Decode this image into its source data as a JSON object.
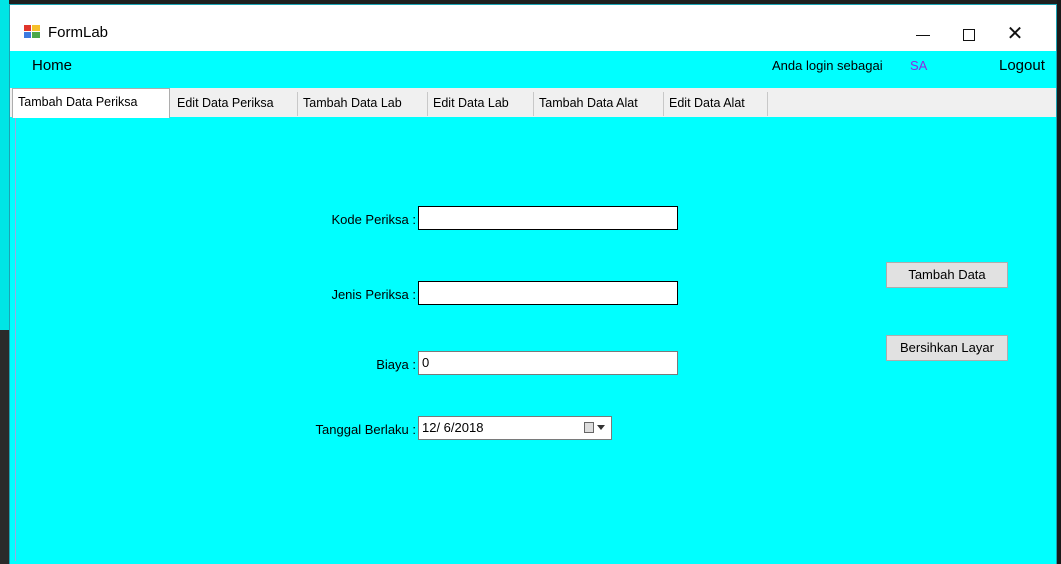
{
  "window": {
    "title": "FormLab",
    "controls": {
      "minimize": "—",
      "maximize": "☐",
      "close": "✕"
    }
  },
  "menu": {
    "home": "Home",
    "login_label": "Anda login sebagai",
    "login_user": "SA",
    "logout": "Logout"
  },
  "tabs": [
    {
      "label": "Tambah Data Periksa",
      "active": true
    },
    {
      "label": "Edit Data Periksa",
      "active": false
    },
    {
      "label": "Tambah Data Lab",
      "active": false
    },
    {
      "label": "Edit Data Lab",
      "active": false
    },
    {
      "label": "Tambah Data Alat",
      "active": false
    },
    {
      "label": "Edit Data Alat",
      "active": false
    }
  ],
  "form": {
    "kode_label": "Kode Periksa :",
    "kode_value": "",
    "jenis_label": "Jenis Periksa :",
    "jenis_value": "",
    "biaya_label": "Biaya :",
    "biaya_value": "0",
    "tanggal_label": "Tanggal Berlaku :",
    "tanggal_value": "12/ 6/2018"
  },
  "buttons": {
    "tambah": "Tambah Data",
    "bersihkan": "Bersihkan Layar"
  },
  "colors": {
    "background": "#00ffff",
    "user_text": "#8a2be2"
  }
}
